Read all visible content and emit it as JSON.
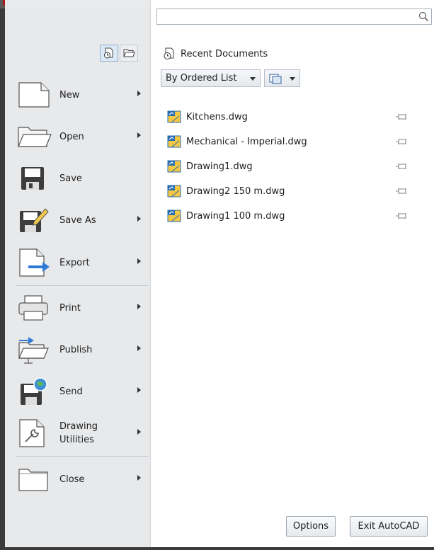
{
  "search": {
    "placeholder": "",
    "value": ""
  },
  "view_toggle": {
    "active": "recent-documents-view",
    "buttons": [
      "recent-documents-view-icon",
      "open-documents-view-icon"
    ]
  },
  "menu": {
    "items": [
      {
        "label": "New",
        "icon": "new-document-icon",
        "has_submenu": true
      },
      {
        "label": "Open",
        "icon": "open-folder-icon",
        "has_submenu": true
      },
      {
        "label": "Save",
        "icon": "save-floppy-icon",
        "has_submenu": false
      },
      {
        "label": "Save As",
        "icon": "save-as-icon",
        "has_submenu": true
      },
      {
        "label": "Export",
        "icon": "export-icon",
        "has_submenu": true
      },
      {
        "label": "Print",
        "icon": "printer-icon",
        "has_submenu": true
      },
      {
        "label": "Publish",
        "icon": "publish-icon",
        "has_submenu": true
      },
      {
        "label": "Send",
        "icon": "send-icon",
        "has_submenu": true
      },
      {
        "label": "Drawing\nUtilities",
        "label_line1": "Drawing",
        "label_line2": "Utilities",
        "icon": "drawing-utilities-icon",
        "has_submenu": true
      },
      {
        "label": "Close",
        "icon": "close-folder-icon",
        "has_submenu": true
      }
    ]
  },
  "recent": {
    "header": "Recent Documents",
    "order_by": "By Ordered List",
    "documents": [
      {
        "name": "Kitchens.dwg"
      },
      {
        "name": "Mechanical - Imperial.dwg"
      },
      {
        "name": "Drawing1.dwg"
      },
      {
        "name": "Drawing2 150 m.dwg"
      },
      {
        "name": "Drawing1 100 m.dwg"
      }
    ]
  },
  "footer": {
    "options_label": "Options",
    "exit_label": "Exit AutoCAD"
  },
  "colors": {
    "menu_bg": "#e8e9eb",
    "accent": "#8fb0d6",
    "app_logo": "#b01818"
  }
}
